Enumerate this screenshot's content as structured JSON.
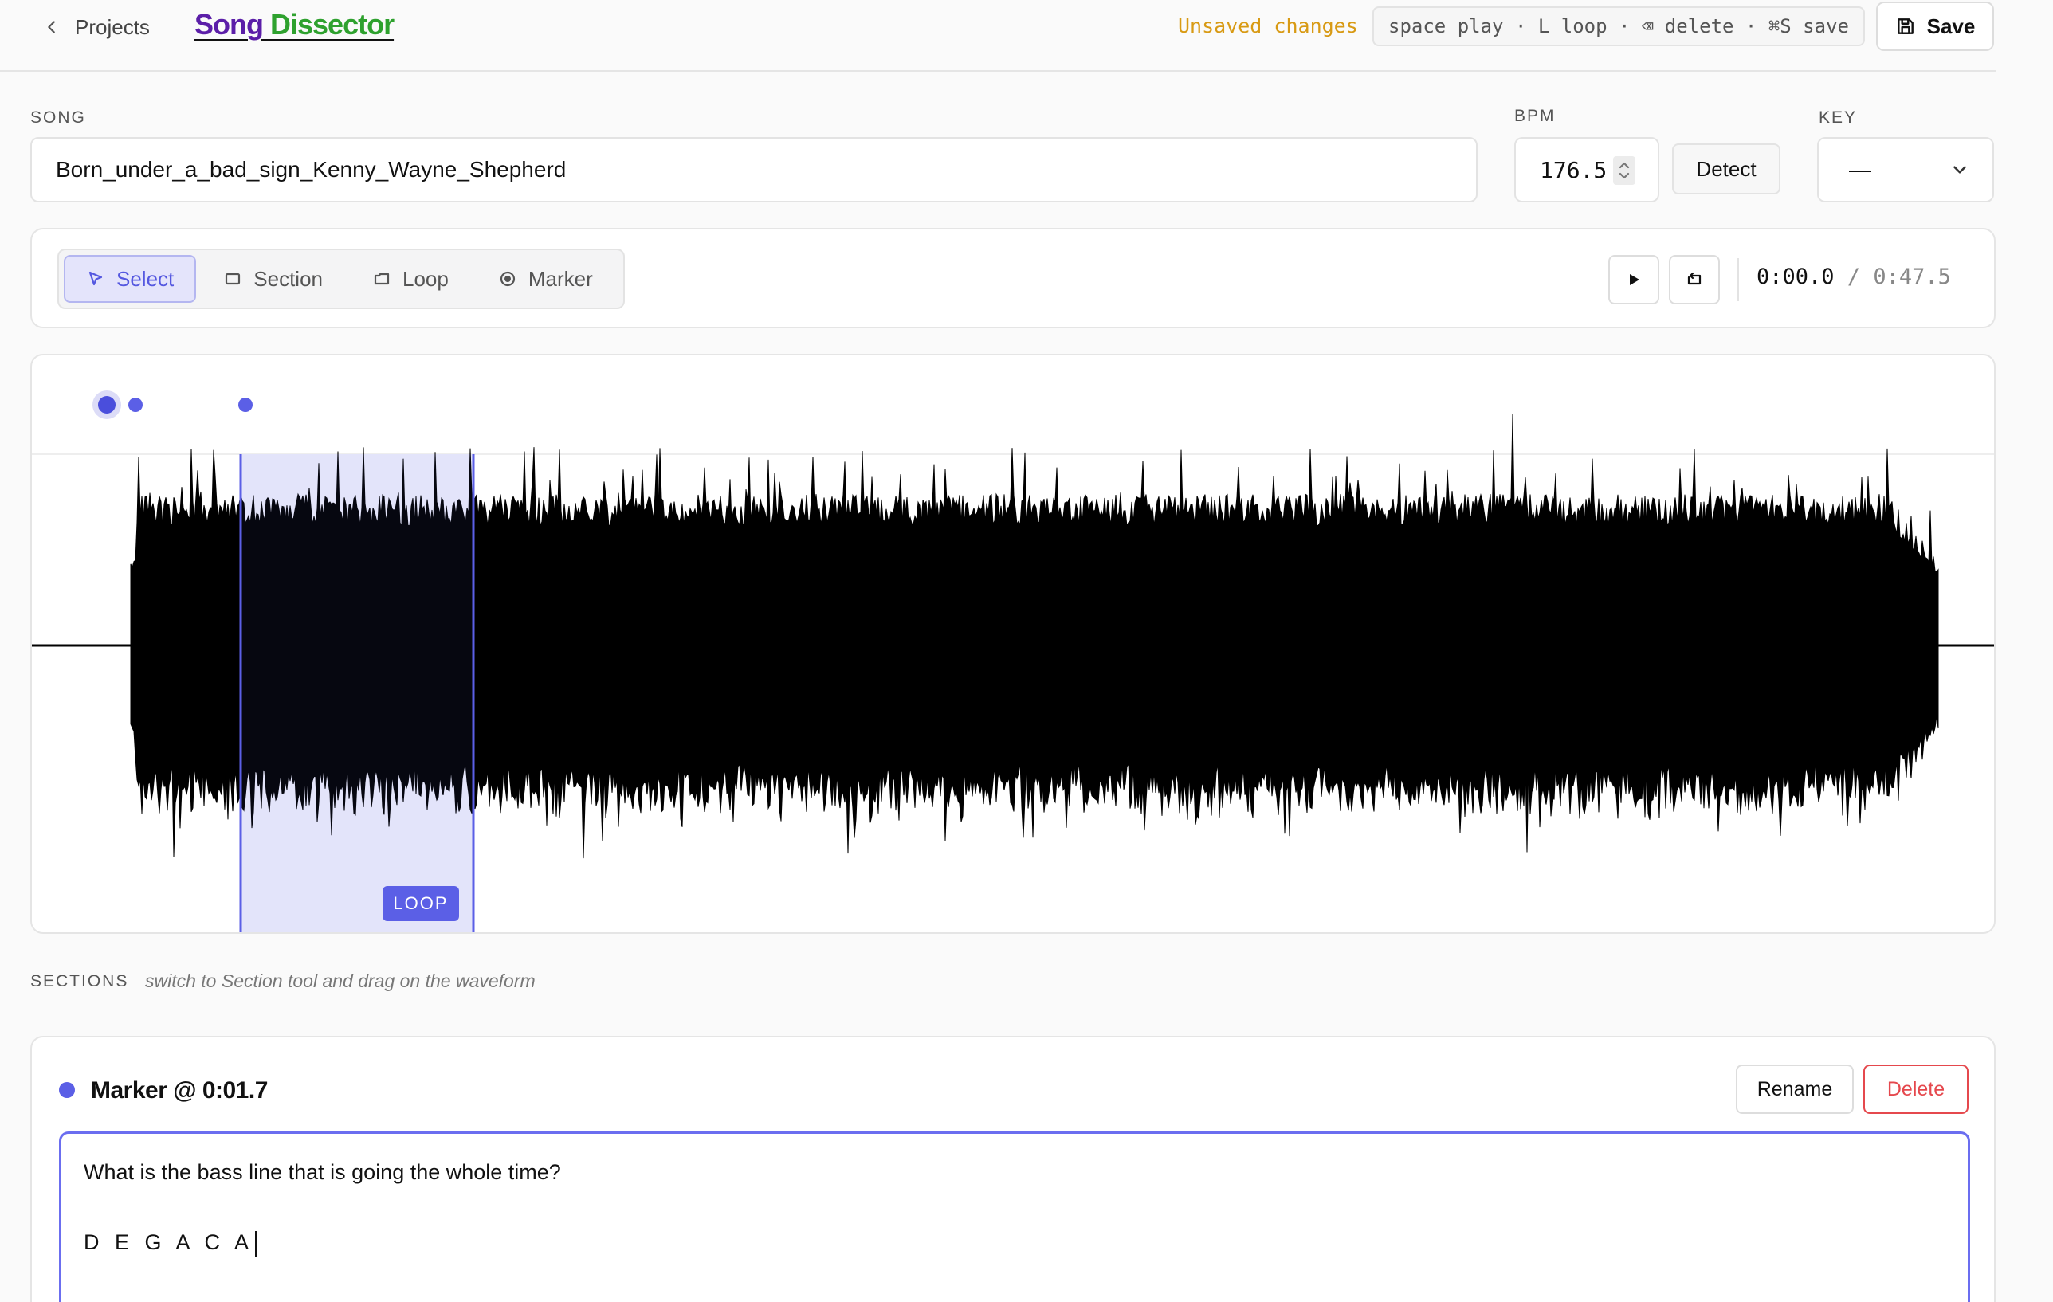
{
  "header": {
    "back_label": "Projects",
    "brand_part1": "Song",
    "brand_part2": "Dissector",
    "status": "Unsaved changes",
    "shortcuts": "space play · L loop · ⌫ delete · ⌘S save",
    "save_label": "Save"
  },
  "fields": {
    "song_label": "SONG",
    "song_value": "Born_under_a_bad_sign_Kenny_Wayne_Shepherd",
    "bpm_label": "BPM",
    "bpm_value": "176.5",
    "detect_label": "Detect",
    "key_label": "KEY",
    "key_value": "—"
  },
  "toolbar": {
    "tools": [
      {
        "label": "Select",
        "icon": "cursor-icon",
        "active": true
      },
      {
        "label": "Section",
        "icon": "square-icon",
        "active": false
      },
      {
        "label": "Loop",
        "icon": "loop-icon",
        "active": false
      },
      {
        "label": "Marker",
        "icon": "marker-icon",
        "active": false
      }
    ],
    "current_time": "0:00.0",
    "separator": "/",
    "total_time": "0:47.5"
  },
  "waveform": {
    "loop_label": "LOOP",
    "duration_seconds": 47.5,
    "loop_start_seconds": 4.3,
    "loop_end_seconds": 9.8,
    "markers_seconds": [
      1.7,
      2.2,
      4.6
    ],
    "colors": {
      "wave": "#000000",
      "accent": "#5b5fe6",
      "loop_fill": "#eeeefc"
    }
  },
  "sections": {
    "label": "SECTIONS",
    "hint": "switch to Section tool and drag on the waveform"
  },
  "marker_card": {
    "title": "Marker @ 0:01.7",
    "rename_label": "Rename",
    "delete_label": "Delete",
    "note_line1": "What is the bass line that is going the whole time?",
    "note_line2": "D E G A C A"
  }
}
